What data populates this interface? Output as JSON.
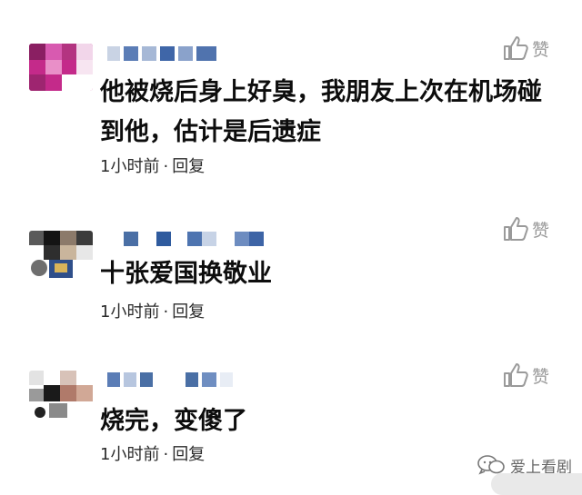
{
  "comments": [
    {
      "text": "他被烧后身上好臭，我朋友上次在机场碰到他，估计是后遗症",
      "time": "1小时前",
      "reply": "回复",
      "like_label": "赞",
      "like_icon": "thumbs-up-icon"
    },
    {
      "text": "十张爱国换敬业",
      "time": "1小时前",
      "reply": "回复",
      "like_label": "赞",
      "like_icon": "thumbs-up-icon"
    },
    {
      "text": "烧完，变傻了",
      "time": "1小时前",
      "reply": "回复",
      "like_label": "赞",
      "like_icon": "thumbs-up-icon"
    }
  ],
  "meta_separator": "·",
  "watermark": {
    "icon": "wechat-icon",
    "text": "爱上看剧"
  },
  "colors": {
    "like_gray": "#999999",
    "name_blue": "#4a6fa5"
  }
}
